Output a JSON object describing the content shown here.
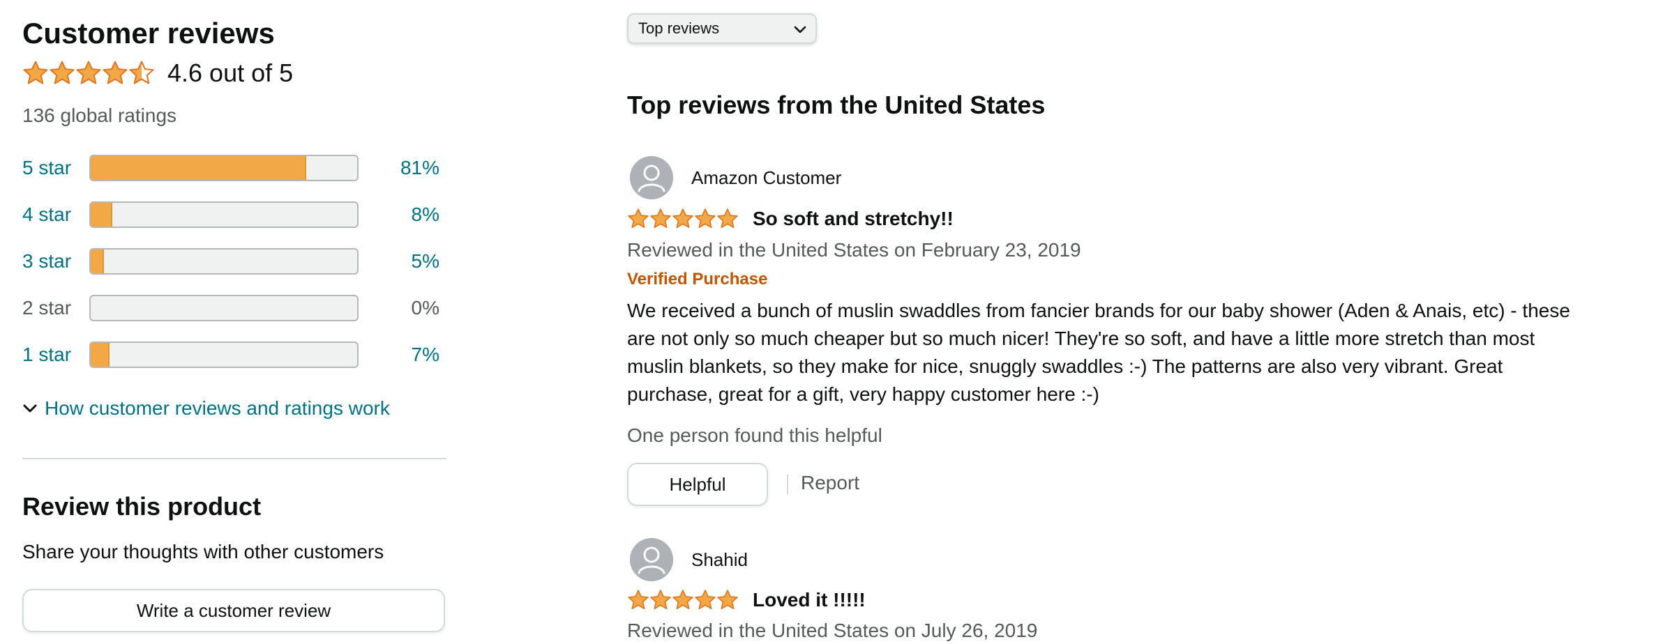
{
  "summary": {
    "title": "Customer reviews",
    "rating": 4.6,
    "rating_text": "4.6 out of 5",
    "global_ratings": "136 global ratings",
    "star_color": "#f3a847"
  },
  "histogram": [
    {
      "label": "5 star",
      "pct_text": "81%",
      "pct": 81
    },
    {
      "label": "4 star",
      "pct_text": "8%",
      "pct": 8
    },
    {
      "label": "3 star",
      "pct_text": "5%",
      "pct": 5
    },
    {
      "label": "2 star",
      "pct_text": "0%",
      "pct": 0
    },
    {
      "label": "1 star",
      "pct_text": "7%",
      "pct": 7
    }
  ],
  "how_link": "How customer reviews and ratings work",
  "review_product": {
    "title": "Review this product",
    "subtitle": "Share your thoughts with other customers",
    "button": "Write a customer review"
  },
  "sort": {
    "selected": "Top reviews"
  },
  "reviews_heading": "Top reviews from the United States",
  "reviews": [
    {
      "author": "Amazon Customer",
      "stars": 5,
      "title": "So soft and stretchy!!",
      "date": "Reviewed in the United States on February 23, 2019",
      "verified": "Verified Purchase",
      "body": "We received a bunch of muslin swaddles from fancier brands for our baby shower (Aden & Anais, etc) - these are not only so much cheaper but so much nicer! They're so soft, and have a little more stretch than most muslin blankets, so they make for nice, snuggly swaddles :-) The patterns are also very vibrant. Great purchase, great for a gift, very happy customer here :-)",
      "helpful_count": "One person found this helpful",
      "helpful_button": "Helpful",
      "report": "Report"
    },
    {
      "author": "Shahid",
      "stars": 5,
      "title": "Loved it !!!!!",
      "date": "Reviewed in the United States on July 26, 2019"
    }
  ]
}
